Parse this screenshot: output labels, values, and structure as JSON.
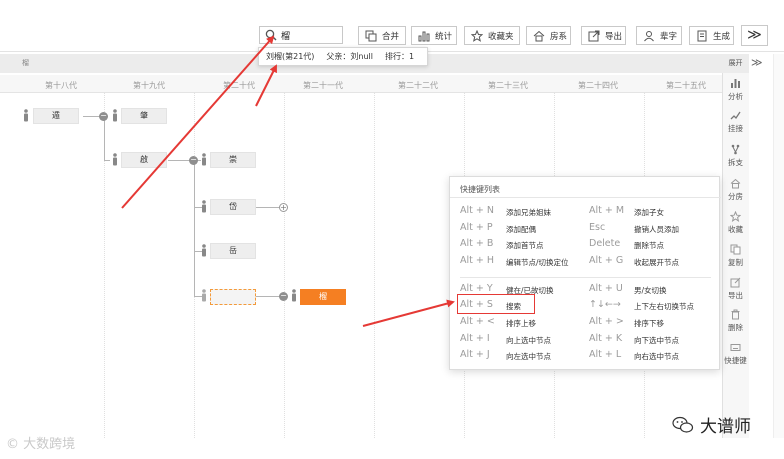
{
  "search": {
    "value": "榴"
  },
  "toolbar": {
    "merge": "合并",
    "stats": "统计",
    "favorites": "收藏夹",
    "house": "房系",
    "export": "导出",
    "generation_char": "辈字",
    "generate": "生成",
    "more": "≫"
  },
  "search_result": {
    "name": "刘榴(第21代)",
    "father": "父亲：刘null",
    "rank": "排行：1"
  },
  "tree": {
    "header_label": "榴",
    "generations": [
      "第十八代",
      "第十九代",
      "第二十代",
      "第二十一代",
      "第二十二代",
      "第二十三代",
      "第二十四代",
      "第二十五代"
    ],
    "nodes": {
      "n18": "遁",
      "n19a": "肇",
      "n19b": "啟",
      "n20a": "崇",
      "n20b": "岱",
      "n20c": "岳",
      "n21": "榴"
    }
  },
  "side_panel": {
    "expand": "展开",
    "chevron": "≫",
    "items": [
      "分析",
      "挂接",
      "拆支",
      "分房",
      "收藏",
      "复制",
      "导出",
      "删除",
      "快捷键"
    ]
  },
  "shortcuts": {
    "title": "快捷键列表",
    "left": [
      {
        "key": "Alt + N",
        "desc": "添加兄弟姐妹"
      },
      {
        "key": "Alt + P",
        "desc": "添加配偶"
      },
      {
        "key": "Alt + B",
        "desc": "添加首节点"
      },
      {
        "key": "Alt + H",
        "desc": "编辑节点/切换定位"
      },
      {
        "key": "Alt + Y",
        "desc": "健在/已故切换"
      },
      {
        "key": "Alt + S",
        "desc": "搜索"
      },
      {
        "key": "Alt + <",
        "desc": "排序上移"
      },
      {
        "key": "Alt + I",
        "desc": "向上选中节点"
      },
      {
        "key": "Alt + J",
        "desc": "向左选中节点"
      }
    ],
    "right": [
      {
        "key": "Alt + M",
        "desc": "添加子女"
      },
      {
        "key": "Esc",
        "desc": "撤销人员添加"
      },
      {
        "key": "Delete",
        "desc": "删除节点"
      },
      {
        "key": "Alt + G",
        "desc": "收起展开节点"
      },
      {
        "key": "Alt + U",
        "desc": "男/女切换"
      },
      {
        "key": "↑↓←→",
        "desc": "上下左右切换节点"
      },
      {
        "key": "Alt + >",
        "desc": "排序下移"
      },
      {
        "key": "Alt + K",
        "desc": "向下选中节点"
      },
      {
        "key": "Alt + L",
        "desc": "向右选中节点"
      }
    ]
  },
  "watermark": {
    "bottom_left": "© 大数跨境",
    "wechat_name": "大谱师"
  },
  "colors": {
    "accent": "#f57f22",
    "arrow": "#e53935",
    "highlight": "#e53935"
  }
}
